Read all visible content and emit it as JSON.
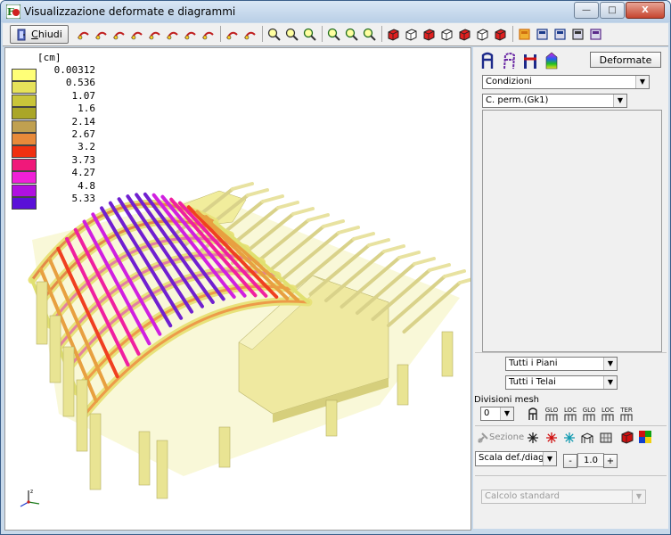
{
  "window": {
    "title": "Visualizzazione deformate e diagrammi",
    "controls": {
      "minimize": "—",
      "maximize": "□",
      "close": "X"
    }
  },
  "toolbar": {
    "close_label_prefix": "C",
    "close_label_rest": "hiudi",
    "icons": [
      "deform-icon-1",
      "deform-icon-2",
      "deform-icon-3",
      "deform-icon-4",
      "deform-icon-5",
      "deform-icon-6",
      "deform-icon-7",
      "deform-icon-8",
      "move-up-icon",
      "move-down-icon",
      "zoom-out-icon",
      "zoom-in-icon",
      "zoom-window-icon",
      "zoom-fit-icon",
      "zoom-prev-icon",
      "zoom-all-icon",
      "view-iso-1-icon",
      "view-iso-2-icon",
      "view-iso-3-icon",
      "view-iso-4-icon",
      "view-iso-5-icon",
      "view-iso-6-icon",
      "view-iso-7-icon",
      "colors-icon",
      "save-icon",
      "export-icon",
      "print-icon",
      "report-icon"
    ]
  },
  "viewport": {
    "unit": "[cm]",
    "legend": [
      {
        "value": "0.00312",
        "color": "#ffff77"
      },
      {
        "value": "0.536",
        "color": "#e6e25a"
      },
      {
        "value": "1.07",
        "color": "#c9c53a"
      },
      {
        "value": "1.6",
        "color": "#aaa628"
      },
      {
        "value": "2.14",
        "color": "#c0a050"
      },
      {
        "value": "2.67",
        "color": "#e88a3a"
      },
      {
        "value": "3.2",
        "color": "#f03010"
      },
      {
        "value": "3.73",
        "color": "#f0187a"
      },
      {
        "value": "4.27",
        "color": "#f020d8"
      },
      {
        "value": "4.8",
        "color": "#b010e0"
      },
      {
        "value": "5.33",
        "color": "#5a10d8"
      }
    ],
    "axes_icon": "xyz-axes-icon"
  },
  "right_panel": {
    "display_icons": [
      "beam-view-icon",
      "beam-outline-icon",
      "frame-section-icon",
      "color-map-icon"
    ],
    "deformate_label": "Deformate",
    "conditions_select": "Condizioni",
    "load_select": "C. perm.(Gk1)",
    "floors_select": "Tutti i Piani",
    "frames_select": "Tutti i Telai",
    "mesh_label": "Divisioni mesh",
    "mesh_value": "0",
    "mesh_icons": [
      {
        "name": "element-icon",
        "text": ""
      },
      {
        "name": "glo-frame-icon",
        "text": "GLO"
      },
      {
        "name": "loc-frame-icon",
        "text": "LOC"
      },
      {
        "name": "glo-arrow-icon",
        "text": "GLO"
      },
      {
        "name": "loc-arrow-icon",
        "text": "LOC"
      },
      {
        "name": "ter-frame-icon",
        "text": "TER"
      }
    ],
    "section_label": "Sezione",
    "scale_select": "Scala def./diag.",
    "scale_minus": "-",
    "scale_value": "1.0",
    "scale_plus": "+",
    "calc_select": "Calcolo standard"
  }
}
